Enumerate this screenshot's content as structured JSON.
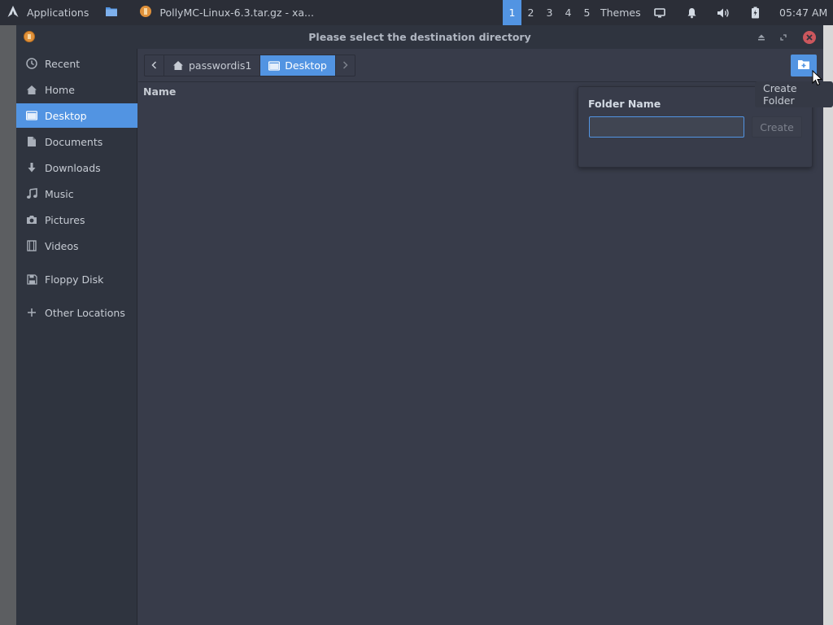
{
  "panel": {
    "apps_label": "Applications",
    "task_label": "PollyMC-Linux-6.3.tar.gz - xa...",
    "workspaces": [
      "1",
      "2",
      "3",
      "4",
      "5"
    ],
    "active_workspace": "1",
    "themes_label": "Themes",
    "clock": "05:47 AM"
  },
  "window": {
    "title": "Please select the destination directory"
  },
  "sidebar": {
    "items": [
      {
        "label": "Recent",
        "icon": "clock-icon"
      },
      {
        "label": "Home",
        "icon": "home-icon"
      },
      {
        "label": "Desktop",
        "icon": "folder-icon"
      },
      {
        "label": "Documents",
        "icon": "document-icon"
      },
      {
        "label": "Downloads",
        "icon": "download-icon"
      },
      {
        "label": "Music",
        "icon": "music-icon"
      },
      {
        "label": "Pictures",
        "icon": "camera-icon"
      },
      {
        "label": "Videos",
        "icon": "film-icon"
      },
      {
        "label": "Floppy Disk",
        "icon": "floppy-icon"
      },
      {
        "label": "Other Locations",
        "icon": "plus-icon"
      }
    ],
    "active": "Desktop"
  },
  "pathbar": {
    "segments": [
      "passwordis1",
      "Desktop"
    ],
    "active": "Desktop"
  },
  "list": {
    "column_name": "Name"
  },
  "popover": {
    "title": "Folder Name",
    "input_value": "",
    "create_label": "Create"
  },
  "tooltip": "Create Folder",
  "colors": {
    "accent": "#5294e2",
    "panel_bg": "#2b2e37",
    "window_bg": "#383c4a",
    "sidebar_bg": "#2f343f",
    "close_red": "#cc575d"
  }
}
